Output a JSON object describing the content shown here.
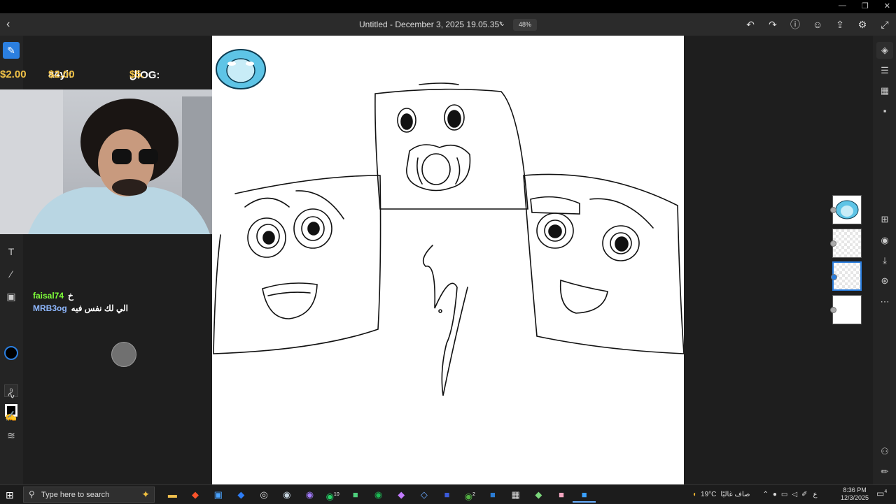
{
  "window": {
    "doc_title": "Untitled - December 3, 2025 19.05.35*",
    "zoom": "48%",
    "controls": [
      "—",
      "❐",
      "✕"
    ]
  },
  "toolbar": {
    "back": "‹",
    "title_chevron": "⌄",
    "icons": [
      "undo-icon",
      "redo-icon",
      "help-icon",
      "account-icon",
      "share-icon",
      "settings-icon",
      "fullscreen-icon"
    ]
  },
  "left_tools": {
    "brush_size": "9"
  },
  "overlay": {
    "ticker": [
      {
        "user": "",
        "amount": "$2.00"
      },
      {
        "user": "a4yi:",
        "amount": "$2.00"
      },
      {
        "user": "الOG:",
        "amount": "$5."
      }
    ],
    "chat": [
      {
        "user": "faisal74",
        "message": "خ"
      },
      {
        "user": "MRB3og",
        "message": "الي لك نفس فيه"
      }
    ]
  },
  "taskbar": {
    "search_placeholder": "Type here to search",
    "weather_temp": "19°C",
    "weather_text": "صاف غالبًا",
    "lang": "ع",
    "time": "8:36 PM",
    "date": "12/3/2025",
    "badge_whatsapp": "10",
    "badge_xbox": "2",
    "notif_count": "4"
  }
}
